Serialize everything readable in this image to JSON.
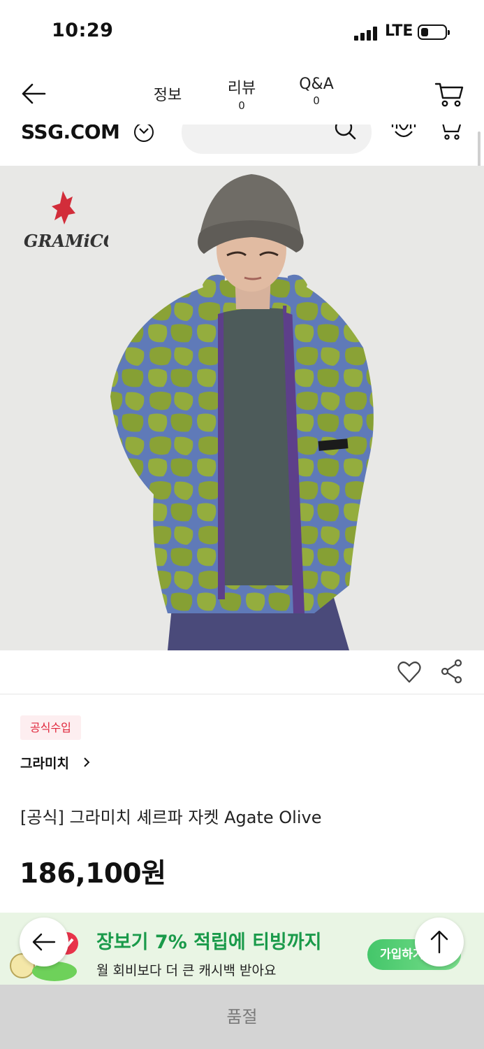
{
  "status_bar": {
    "time": "10:29",
    "network": "LTE",
    "battery_level": 0.3
  },
  "nav": {
    "tabs": [
      {
        "label": "정보",
        "count": ""
      },
      {
        "label": "리뷰",
        "count": "0"
      },
      {
        "label": "Q&A",
        "count": "0"
      }
    ]
  },
  "header": {
    "logo": "SSG.COM"
  },
  "product": {
    "image_brand_logo": "GRAMiCCi",
    "badge": "공식수입",
    "brand": "그라미치",
    "title": "[공식] 그라미치 셰르파 자켓 Agate Olive",
    "price": "186,100원"
  },
  "promo": {
    "title": "장보기 7% 적립에 티빙까지",
    "subtitle": "월 회비보다 더 큰 캐시백 받아요",
    "join_label": "가입하기 >"
  },
  "bottom_bar": {
    "label": "품절"
  },
  "icons": [
    "back-arrow-icon",
    "cart-icon",
    "chevron-down-icon",
    "search-icon",
    "voice-icon",
    "heart-icon",
    "share-icon",
    "chevron-right-icon",
    "arrow-up-icon"
  ],
  "colors": {
    "badge_text": "#e0263b",
    "badge_bg": "#fdeef0",
    "promo_green": "#1a9a4a",
    "soldout_bg": "#d4d4d4"
  }
}
